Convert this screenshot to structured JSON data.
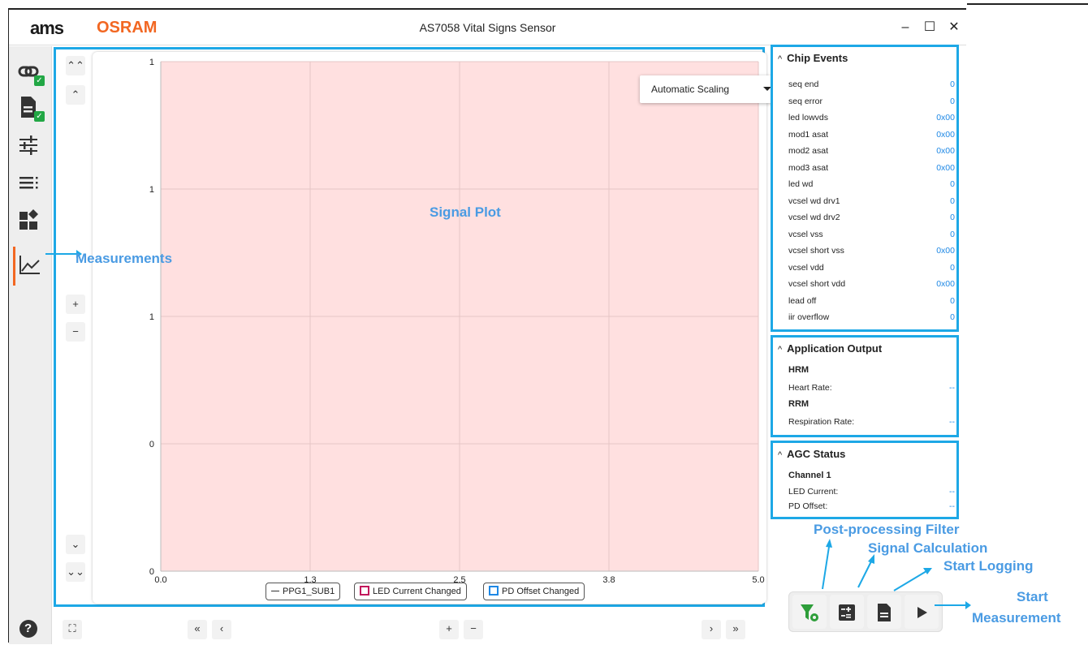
{
  "window": {
    "title": "AS7058 Vital Signs Sensor",
    "logo_ams": "ams",
    "logo_osram": "OSRAM",
    "minimize": "–",
    "maximize": "☐",
    "close": "✕"
  },
  "sidebar": {
    "items": [
      {
        "icon": "link-icon",
        "checked": true
      },
      {
        "icon": "document-icon",
        "checked": true
      },
      {
        "icon": "sliders-icon"
      },
      {
        "icon": "list-icon"
      },
      {
        "icon": "widgets-icon"
      },
      {
        "icon": "chart-line-icon",
        "active": true
      }
    ],
    "help": "?"
  },
  "plot": {
    "scaling": "Automatic Scaling",
    "background": "#ffe0e0",
    "zoom_buttons": [
      "⌃⌃",
      "⌃",
      "+",
      "−",
      "⌄",
      "⌄⌄"
    ],
    "legend": [
      {
        "label": "PPG1_SUB1",
        "kind": "line",
        "color": "#333333"
      },
      {
        "label": "LED Current Changed",
        "kind": "box",
        "color": "#c2185b"
      },
      {
        "label": "PD Offset Changed",
        "kind": "box",
        "color": "#1e88e5"
      }
    ],
    "nav": {
      "first": "«",
      "prev": "‹",
      "zoom_in": "+",
      "zoom_out": "−",
      "next": "›",
      "last": "»",
      "fit": "⛶"
    }
  },
  "chart_data": {
    "type": "line",
    "title": "",
    "xlabel": "",
    "ylabel": "",
    "xlim": [
      0.0,
      5.0
    ],
    "x_ticks": [
      "0.0",
      "1.3",
      "2.5",
      "3.8",
      "5.0"
    ],
    "y_ticks": [
      "1",
      "1",
      "1",
      "0",
      "0"
    ],
    "series": [
      {
        "name": "PPG1_SUB1",
        "values": []
      }
    ],
    "grid": true
  },
  "annotations": {
    "signal_plot": "Signal Plot",
    "measurements": "Measurements",
    "post_filter": "Post-processing Filter",
    "signal_calc": "Signal Calculation",
    "start_logging": "Start Logging",
    "start_measurement_1": "Start",
    "start_measurement_2": "Measurement"
  },
  "chip_events": {
    "title": "Chip Events",
    "rows": [
      {
        "label": "seq end",
        "value": "0"
      },
      {
        "label": "seq error",
        "value": "0"
      },
      {
        "label": "led lowvds",
        "value": "0x00"
      },
      {
        "label": "mod1 asat",
        "value": "0x00"
      },
      {
        "label": "mod2 asat",
        "value": "0x00"
      },
      {
        "label": "mod3 asat",
        "value": "0x00"
      },
      {
        "label": "led wd",
        "value": "0"
      },
      {
        "label": "vcsel wd drv1",
        "value": "0"
      },
      {
        "label": "vcsel wd drv2",
        "value": "0"
      },
      {
        "label": "vcsel vss",
        "value": "0"
      },
      {
        "label": "vcsel short vss",
        "value": "0x00"
      },
      {
        "label": "vcsel vdd",
        "value": "0"
      },
      {
        "label": "vcsel short vdd",
        "value": "0x00"
      },
      {
        "label": "lead off",
        "value": "0"
      },
      {
        "label": "iir overflow",
        "value": "0"
      }
    ]
  },
  "app_output": {
    "title": "Application Output",
    "hrm": "HRM",
    "heart_rate_label": "Heart Rate:",
    "heart_rate_value": "--",
    "rrm": "RRM",
    "resp_rate_label": "Respiration Rate:",
    "resp_rate_value": "--"
  },
  "agc_status": {
    "title": "AGC Status",
    "channel": "Channel 1",
    "led_current_label": "LED Current:",
    "led_current_value": "--",
    "pd_offset_label": "PD Offset:",
    "pd_offset_value": "--"
  },
  "colors": {
    "accent": "#1da8e6",
    "brand": "#f26722",
    "value": "#1e88e5",
    "filter": "#2e9e3a"
  }
}
